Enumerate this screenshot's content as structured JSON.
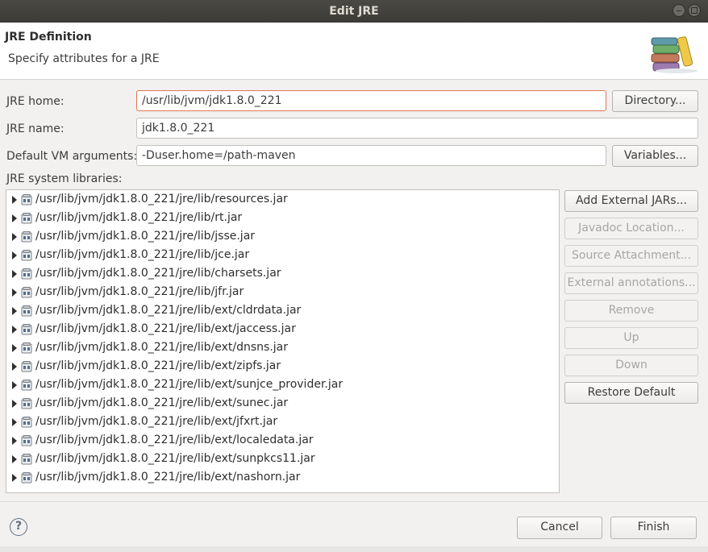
{
  "window": {
    "title": "Edit JRE"
  },
  "header": {
    "title": "JRE Definition",
    "subtitle": "Specify attributes for a JRE",
    "banner_icon": "books-icon"
  },
  "form": {
    "jre_home_label": "JRE home:",
    "jre_home_value": "/usr/lib/jvm/jdk1.8.0_221",
    "directory_button": "Directory...",
    "jre_name_label": "JRE name:",
    "jre_name_value": "jdk1.8.0_221",
    "vm_args_label": "Default VM arguments:",
    "vm_args_value": "-Duser.home=/path-maven",
    "variables_button": "Variables..."
  },
  "libraries": {
    "label": "JRE system libraries:",
    "items": [
      "/usr/lib/jvm/jdk1.8.0_221/jre/lib/resources.jar",
      "/usr/lib/jvm/jdk1.8.0_221/jre/lib/rt.jar",
      "/usr/lib/jvm/jdk1.8.0_221/jre/lib/jsse.jar",
      "/usr/lib/jvm/jdk1.8.0_221/jre/lib/jce.jar",
      "/usr/lib/jvm/jdk1.8.0_221/jre/lib/charsets.jar",
      "/usr/lib/jvm/jdk1.8.0_221/jre/lib/jfr.jar",
      "/usr/lib/jvm/jdk1.8.0_221/jre/lib/ext/cldrdata.jar",
      "/usr/lib/jvm/jdk1.8.0_221/jre/lib/ext/jaccess.jar",
      "/usr/lib/jvm/jdk1.8.0_221/jre/lib/ext/dnsns.jar",
      "/usr/lib/jvm/jdk1.8.0_221/jre/lib/ext/zipfs.jar",
      "/usr/lib/jvm/jdk1.8.0_221/jre/lib/ext/sunjce_provider.jar",
      "/usr/lib/jvm/jdk1.8.0_221/jre/lib/ext/sunec.jar",
      "/usr/lib/jvm/jdk1.8.0_221/jre/lib/ext/jfxrt.jar",
      "/usr/lib/jvm/jdk1.8.0_221/jre/lib/ext/localedata.jar",
      "/usr/lib/jvm/jdk1.8.0_221/jre/lib/ext/sunpkcs11.jar",
      "/usr/lib/jvm/jdk1.8.0_221/jre/lib/ext/nashorn.jar"
    ]
  },
  "side_buttons": {
    "add_external_jars": "Add External JARs...",
    "javadoc_location": "Javadoc Location...",
    "source_attachment": "Source Attachment...",
    "external_annotations": "External annotations...",
    "remove": "Remove",
    "up": "Up",
    "down": "Down",
    "restore_default": "Restore Default"
  },
  "footer": {
    "help": "?",
    "cancel": "Cancel",
    "finish": "Finish"
  }
}
